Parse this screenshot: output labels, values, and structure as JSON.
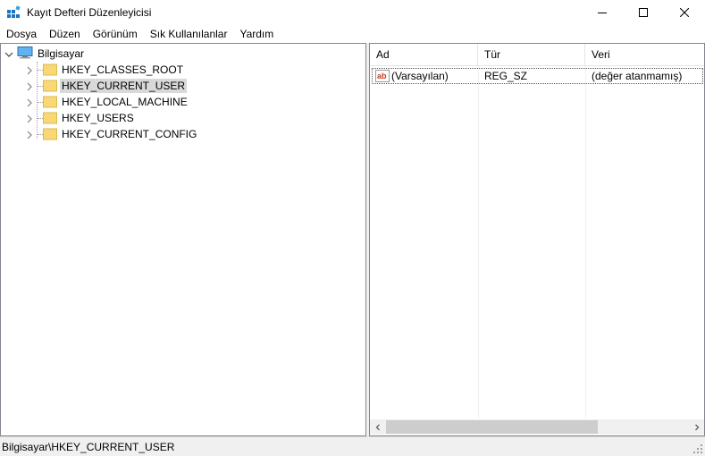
{
  "window": {
    "title": "Kayıt Defteri Düzenleyicisi",
    "icon": "registry-editor-icon",
    "controls": [
      "minimize-icon",
      "maximize-icon",
      "close-icon"
    ]
  },
  "menu": {
    "items": [
      "Dosya",
      "Düzen",
      "Görünüm",
      "Sık Kullanılanlar",
      "Yardım"
    ]
  },
  "tree": {
    "root": "Bilgisayar",
    "children": [
      {
        "label": "HKEY_CLASSES_ROOT",
        "selected": false
      },
      {
        "label": "HKEY_CURRENT_USER",
        "selected": true
      },
      {
        "label": "HKEY_LOCAL_MACHINE",
        "selected": false
      },
      {
        "label": "HKEY_USERS",
        "selected": false
      },
      {
        "label": "HKEY_CURRENT_CONFIG",
        "selected": false
      }
    ]
  },
  "list": {
    "columns": [
      "Ad",
      "Tür",
      "Veri"
    ],
    "rows": [
      {
        "name": "(Varsayılan)",
        "type": "REG_SZ",
        "data": "(değer atanmamış)",
        "icon": "string-value-icon"
      }
    ]
  },
  "status": {
    "path": "Bilgisayar\\HKEY_CURRENT_USER"
  },
  "colors": {
    "selection": "#d9d9d9",
    "folder": "#f8d775",
    "border": "#828790",
    "statusbar": "#f0f0f0"
  }
}
